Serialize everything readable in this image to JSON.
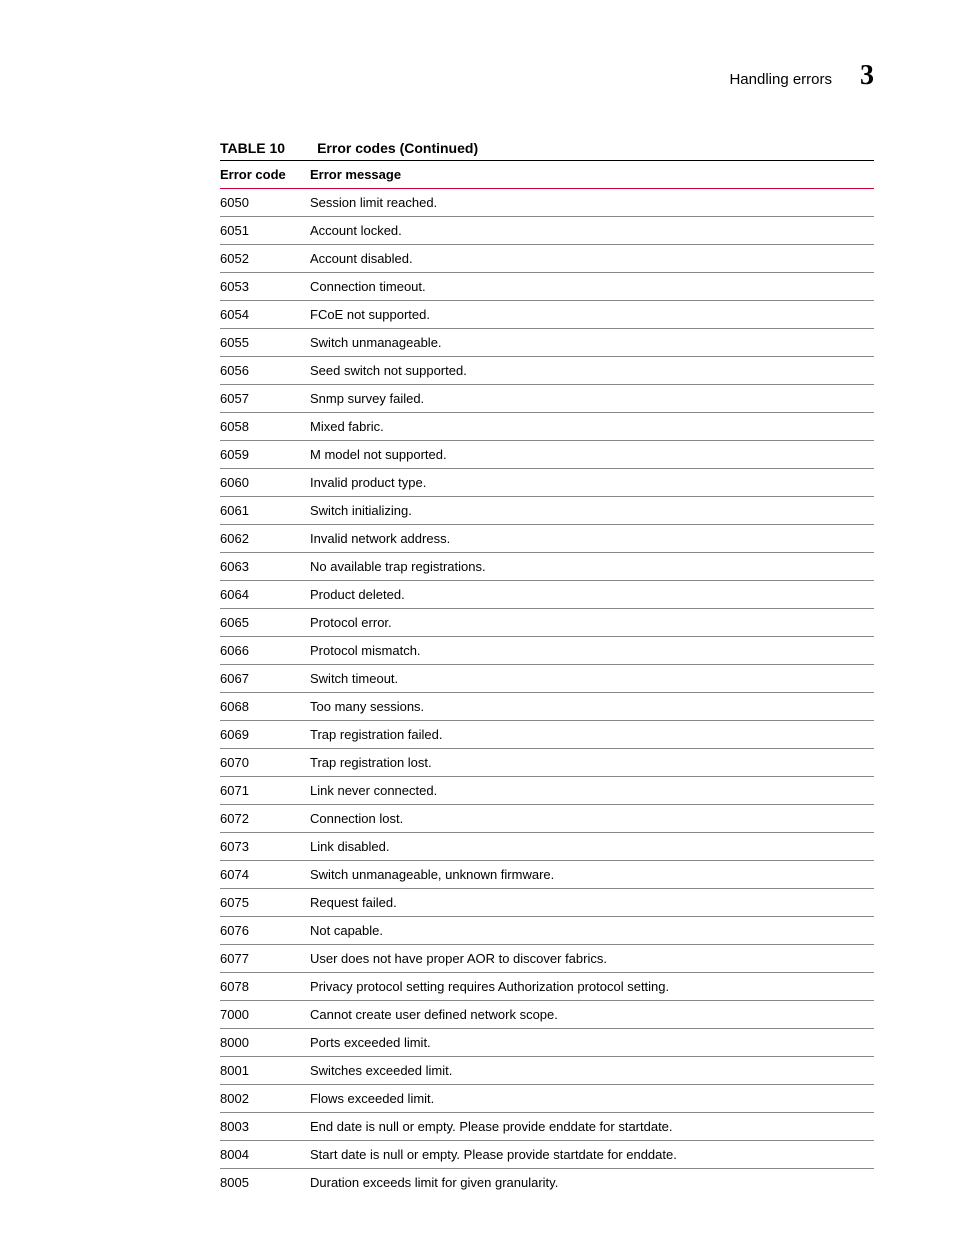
{
  "header": {
    "section": "Handling errors",
    "chapter": "3"
  },
  "table": {
    "label": "TABLE 10",
    "caption": "Error codes (Continued)",
    "columns": [
      "Error code",
      "Error message"
    ],
    "rows": [
      {
        "code": "6050",
        "msg": "Session limit reached."
      },
      {
        "code": "6051",
        "msg": "Account locked."
      },
      {
        "code": "6052",
        "msg": "Account disabled."
      },
      {
        "code": "6053",
        "msg": "Connection timeout."
      },
      {
        "code": "6054",
        "msg": "FCoE not supported."
      },
      {
        "code": "6055",
        "msg": "Switch unmanageable."
      },
      {
        "code": "6056",
        "msg": "Seed switch not supported."
      },
      {
        "code": "6057",
        "msg": "Snmp survey failed."
      },
      {
        "code": "6058",
        "msg": "Mixed fabric."
      },
      {
        "code": "6059",
        "msg": "M model not supported."
      },
      {
        "code": "6060",
        "msg": "Invalid product type."
      },
      {
        "code": "6061",
        "msg": "Switch initializing."
      },
      {
        "code": "6062",
        "msg": "Invalid network address."
      },
      {
        "code": "6063",
        "msg": "No available trap registrations."
      },
      {
        "code": "6064",
        "msg": "Product deleted."
      },
      {
        "code": "6065",
        "msg": "Protocol error."
      },
      {
        "code": "6066",
        "msg": "Protocol mismatch."
      },
      {
        "code": "6067",
        "msg": "Switch timeout."
      },
      {
        "code": "6068",
        "msg": "Too many sessions."
      },
      {
        "code": "6069",
        "msg": "Trap registration failed."
      },
      {
        "code": "6070",
        "msg": "Trap registration lost."
      },
      {
        "code": "6071",
        "msg": "Link never connected."
      },
      {
        "code": "6072",
        "msg": "Connection lost."
      },
      {
        "code": "6073",
        "msg": "Link disabled."
      },
      {
        "code": "6074",
        "msg": "Switch unmanageable, unknown firmware."
      },
      {
        "code": "6075",
        "msg": "Request failed."
      },
      {
        "code": "6076",
        "msg": "Not capable."
      },
      {
        "code": "6077",
        "msg": "User does not have proper AOR to discover fabrics."
      },
      {
        "code": "6078",
        "msg": "Privacy protocol setting requires Authorization protocol setting."
      },
      {
        "code": "7000",
        "msg": "Cannot create user defined network scope."
      },
      {
        "code": "8000",
        "msg": "Ports exceeded limit."
      },
      {
        "code": "8001",
        "msg": "Switches exceeded limit."
      },
      {
        "code": "8002",
        "msg": "Flows exceeded limit."
      },
      {
        "code": "8003",
        "msg": "End date is null or empty. Please provide enddate for startdate."
      },
      {
        "code": "8004",
        "msg": "Start date is null or empty. Please provide startdate for enddate."
      },
      {
        "code": "8005",
        "msg": "Duration exceeds limit for given granularity."
      }
    ]
  }
}
